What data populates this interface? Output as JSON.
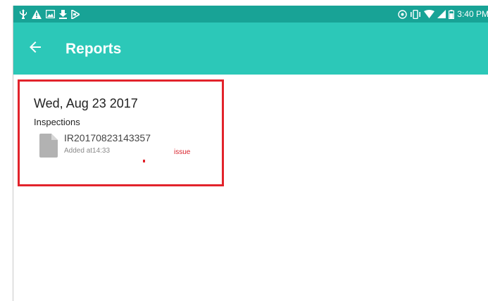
{
  "status_bar": {
    "time": "3:40 PM",
    "left_icons": [
      "usb-icon",
      "warning-icon",
      "image-icon",
      "download-icon",
      "media-icon"
    ],
    "right_icons": [
      "sync-icon",
      "vibrate-icon",
      "wifi-icon",
      "signal-icon",
      "battery-icon"
    ]
  },
  "app_bar": {
    "title": "Reports",
    "back_icon": "arrow-back-icon",
    "color": "#2cc8b8"
  },
  "report_card": {
    "date": "Wed, Aug 23 2017",
    "section_label": "Inspections",
    "highlight_color": "#e2232b",
    "items": [
      {
        "id": "IR20170823143357",
        "added": "Added at14:33",
        "status": "issue",
        "icon": "document-icon"
      }
    ]
  },
  "colors": {
    "status_bar": "#18a396",
    "app_bar": "#2cc8b8",
    "issue": "#d9232d"
  }
}
